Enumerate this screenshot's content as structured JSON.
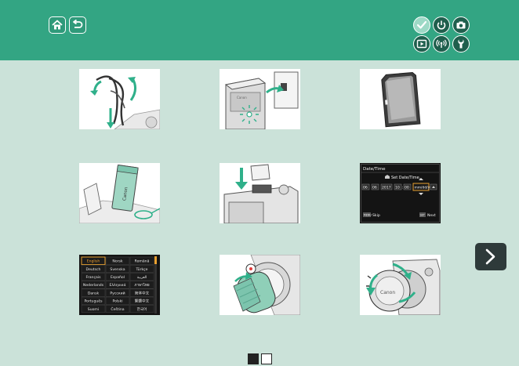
{
  "header": {
    "home_icon": "home-icon",
    "back_icon": "back-arrow-icon",
    "category_icons": [
      "checkmark-icon",
      "power-icon",
      "camera-icon",
      "playback-icon",
      "wireless-icon",
      "tools-icon"
    ],
    "colors": {
      "header_bg": "#33a583",
      "page_bg": "#cbe2d9",
      "active_category": "#9dd9c6"
    }
  },
  "thumbnails": {
    "card": {
      "brand": "Canon"
    },
    "battery": {
      "brand": "Canon"
    },
    "lens_cap": {
      "brand": "Canon"
    },
    "date_time": {
      "title": "Date/Time",
      "subtitle": "Set Date/Time.",
      "day": "06",
      "month": "06",
      "year": "2017",
      "hour": "10",
      "minute": "00",
      "format": "mm/dd/yy",
      "skip_key": "MENU",
      "skip_label": "Skip",
      "next_key": "SET",
      "next_label": "Next"
    },
    "languages": {
      "rows": [
        [
          "English",
          "Norsk",
          "Română"
        ],
        [
          "Deutsch",
          "Svenska",
          "Türkçe"
        ],
        [
          "Français",
          "Español",
          "العربية"
        ],
        [
          "Nederlands",
          "Ελληνικά",
          "ภาษาไทย"
        ],
        [
          "Dansk",
          "Русский",
          "简体中文"
        ],
        [
          "Português",
          "Polski",
          "繁體中文"
        ],
        [
          "Suomi",
          "Čeština",
          "한국어"
        ]
      ]
    }
  },
  "navigation": {
    "next_icon": "chevron-right-icon",
    "current_page": 1,
    "total_pages": 2
  }
}
